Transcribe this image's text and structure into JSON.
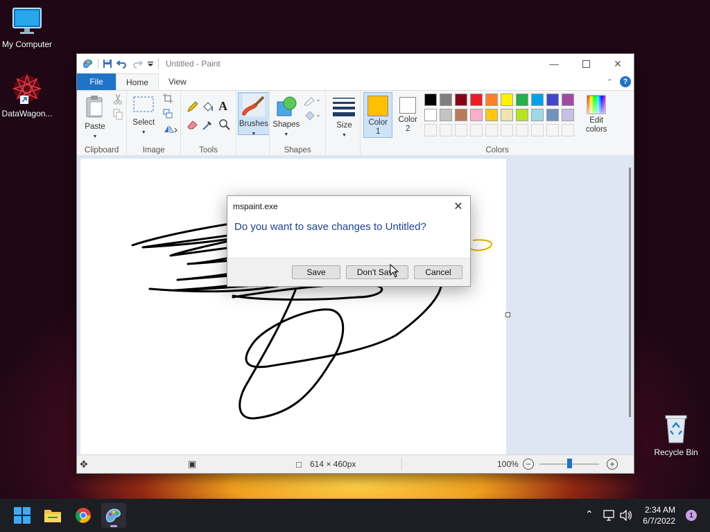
{
  "desktop": {
    "icons": [
      {
        "label": "My Computer"
      },
      {
        "label": "DataWagon..."
      },
      {
        "label": "Recycle Bin"
      }
    ]
  },
  "window": {
    "title": "Untitled - Paint",
    "tabs": {
      "file": "File",
      "home": "Home",
      "view": "View"
    },
    "help": "?"
  },
  "ribbon": {
    "clipboard": {
      "paste": "Paste",
      "label": "Clipboard"
    },
    "image": {
      "select": "Select",
      "label": "Image"
    },
    "tools": {
      "label": "Tools"
    },
    "brushes": {
      "label": "Brushes"
    },
    "shapes": {
      "shapes": "Shapes",
      "label": "Shapes"
    },
    "size": {
      "label": "Size"
    },
    "colors": {
      "color1": "Color\n1",
      "color2": "Color\n2",
      "edit": "Edit\ncolors",
      "label": "Colors",
      "color1_value": "#ffc000",
      "color2_value": "#ffffff",
      "palette_row1": [
        "#000000",
        "#7f7f7f",
        "#880015",
        "#ed1c24",
        "#ff7f27",
        "#fff200",
        "#22b14c",
        "#00a2e8",
        "#3f48cc",
        "#a349a4"
      ],
      "palette_row2": [
        "#ffffff",
        "#c3c3c3",
        "#b97a57",
        "#ffaec9",
        "#ffc90e",
        "#efe4b0",
        "#b5e61d",
        "#99d9ea",
        "#7092be",
        "#c8bfe7"
      ]
    }
  },
  "statusbar": {
    "dimensions": "614 × 460px",
    "zoom": "100%",
    "zoom_level": 0.5
  },
  "dialog": {
    "title": "mspaint.exe",
    "message": "Do you want to save changes to Untitled?",
    "save": "Save",
    "dont_save": "Don't Save",
    "cancel": "Cancel"
  },
  "taskbar": {
    "time": "2:34 AM",
    "date": "6/7/2022",
    "notification_count": "1"
  }
}
